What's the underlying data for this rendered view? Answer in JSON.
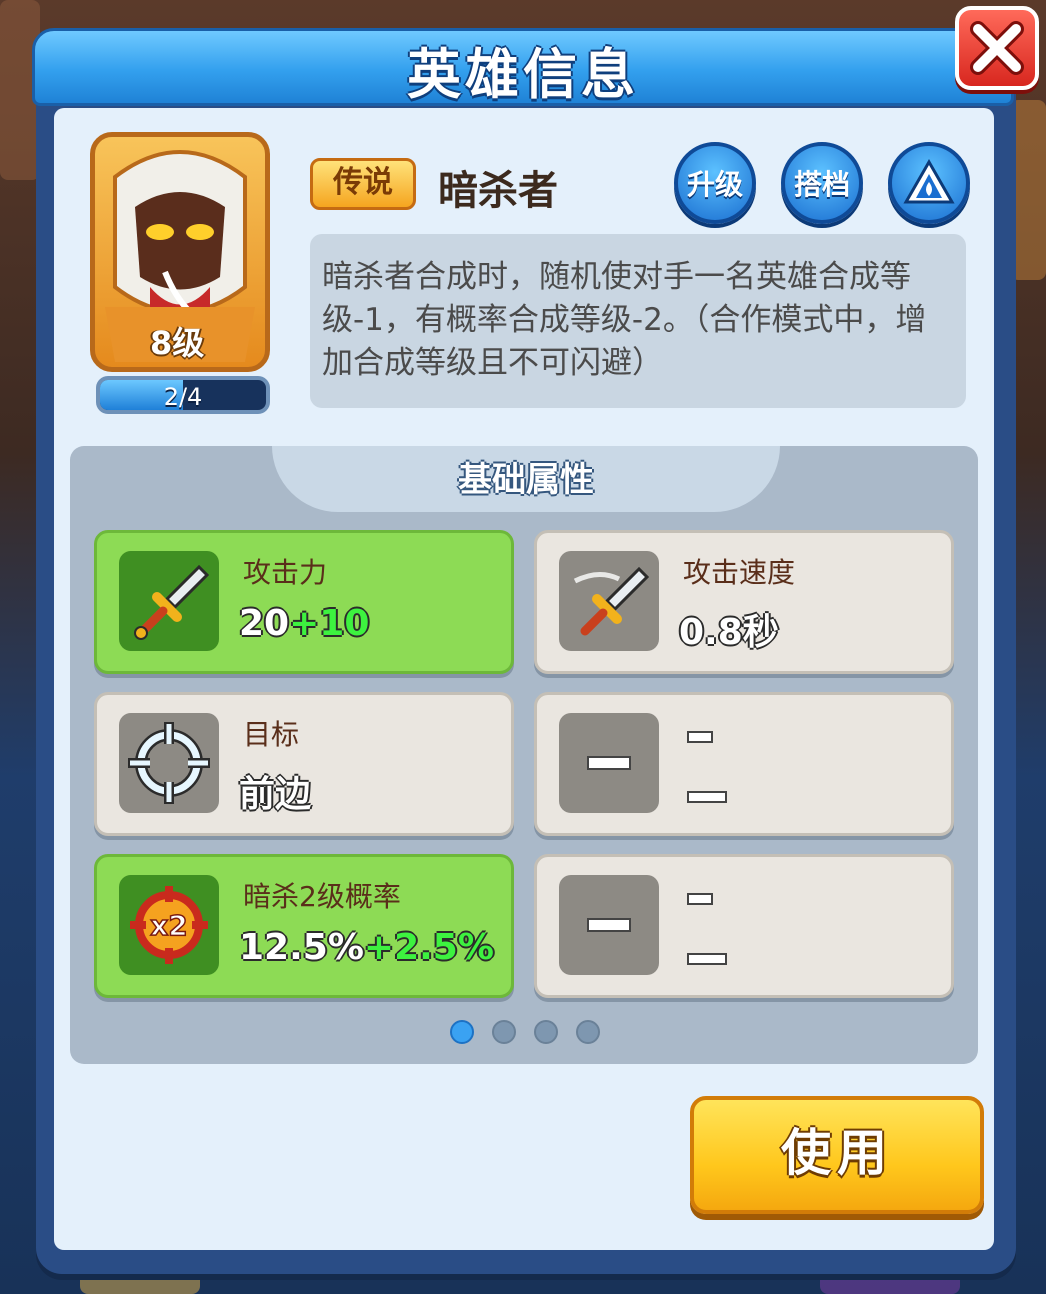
{
  "dialog": {
    "title": "英雄信息",
    "close_icon": "close-icon"
  },
  "hero": {
    "level_label": "8级",
    "progress_text": "2/4",
    "progress_fraction": 0.5,
    "rarity": "传说",
    "name": "暗杀者",
    "description": "暗杀者合成时，随机使对手一名英雄合成等级-1，有概率合成等级-2。（合作模式中，增加合成等级且不可闪避）"
  },
  "actions": {
    "upgrade_label": "升级",
    "partner_label": "搭档",
    "third_icon": "flame-triangle-icon"
  },
  "attributes": {
    "title": "基础属性",
    "cards": [
      {
        "label": "攻击力",
        "value": "20",
        "bonus": "+10",
        "icon": "sword-icon"
      },
      {
        "label": "攻击速度",
        "value": "0.8秒",
        "bonus": "",
        "icon": "swinging-sword-icon"
      },
      {
        "label": "目标",
        "value": "前边",
        "bonus": "",
        "icon": "crosshair-icon"
      },
      {
        "label": "暗杀2级概率",
        "value": "12.5%",
        "bonus": "+2.5%",
        "icon": "x2-target-icon"
      }
    ],
    "empty_label": "–"
  },
  "pagination": {
    "total": 4,
    "active": 1
  },
  "use_button_label": "使用"
}
